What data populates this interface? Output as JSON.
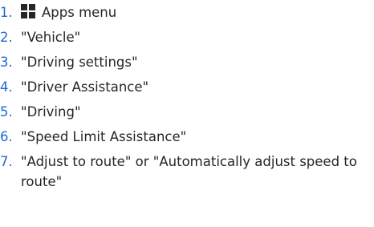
{
  "steps": [
    {
      "number": "1.",
      "text": "Apps menu",
      "icon": "apps-grid-icon"
    },
    {
      "number": "2.",
      "text": "\"Vehicle\""
    },
    {
      "number": "3.",
      "text": "\"Driving settings\""
    },
    {
      "number": "4.",
      "text": "\"Driver Assistance\""
    },
    {
      "number": "5.",
      "text": "\"Driving\""
    },
    {
      "number": "6.",
      "text": "\"Speed Limit Assistance\""
    },
    {
      "number": "7.",
      "text": "\"Adjust to route\" or \"Automatically adjust speed to route\""
    }
  ],
  "colors": {
    "number": "#1c69d4",
    "text": "#262626",
    "icon": "#262626"
  }
}
